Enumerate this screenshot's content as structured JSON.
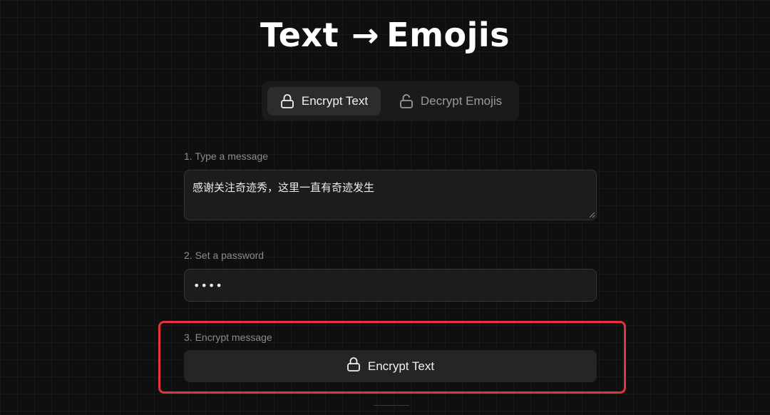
{
  "header": {
    "title_left": "Text",
    "arrow": "→",
    "title_right": "Emojis"
  },
  "tabs": [
    {
      "label": "Encrypt Text",
      "icon": "lock-closed-icon",
      "active": true
    },
    {
      "label": "Decrypt Emojis",
      "icon": "lock-open-icon",
      "active": false
    }
  ],
  "form": {
    "message_label": "1. Type a message",
    "message_value": "感谢关注奇迹秀，这里一直有奇迹发生",
    "password_label": "2. Set a password",
    "password_value": "••••",
    "encrypt_label": "3. Encrypt message",
    "encrypt_button": "Encrypt Text"
  },
  "colors": {
    "background": "#0f0f0f",
    "highlight_border": "#e5323f",
    "active_tab": "#2c2c2c",
    "button": "#252525"
  }
}
